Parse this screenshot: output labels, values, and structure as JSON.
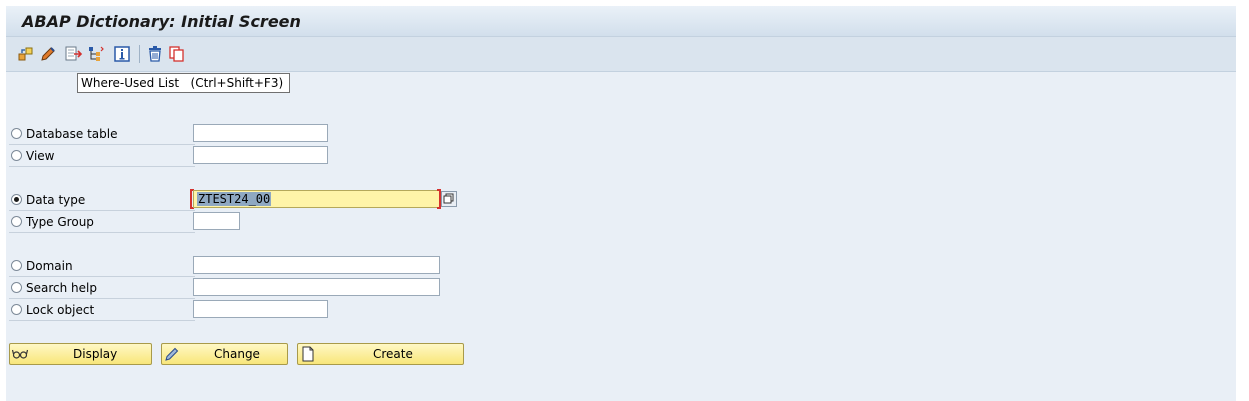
{
  "window": {
    "title": "ABAP Dictionary: Initial Screen"
  },
  "toolbar": {
    "buttons": [
      {
        "icon": "other-object-icon"
      },
      {
        "icon": "edit-pencil-icon"
      },
      {
        "icon": "where-used-list-icon"
      },
      {
        "icon": "hierarchy-icon"
      },
      {
        "icon": "info-icon"
      },
      {
        "icon": "delete-icon"
      },
      {
        "icon": "copy-icon"
      }
    ],
    "tooltip": "Where-Used List   (Ctrl+Shift+F3)"
  },
  "form": {
    "options": [
      {
        "label": "Database table",
        "value": "",
        "selected": false
      },
      {
        "label": "View",
        "value": "",
        "selected": false
      },
      {
        "label": "Data type",
        "value": "ZTEST24_00",
        "selected": true
      },
      {
        "label": "Type Group",
        "value": "",
        "selected": false
      },
      {
        "label": "Domain",
        "value": "",
        "selected": false
      },
      {
        "label": "Search help",
        "value": "",
        "selected": false
      },
      {
        "label": "Lock object",
        "value": "",
        "selected": false
      }
    ]
  },
  "actions": {
    "display": "Display",
    "change": "Change",
    "create": "Create"
  },
  "colors": {
    "title_bar": "#dae4ee",
    "content_bg": "#e9eff6",
    "active_field": "#fff4a8",
    "button_yellow": "#f8e67a",
    "focus_bracket": "#d4322e"
  }
}
